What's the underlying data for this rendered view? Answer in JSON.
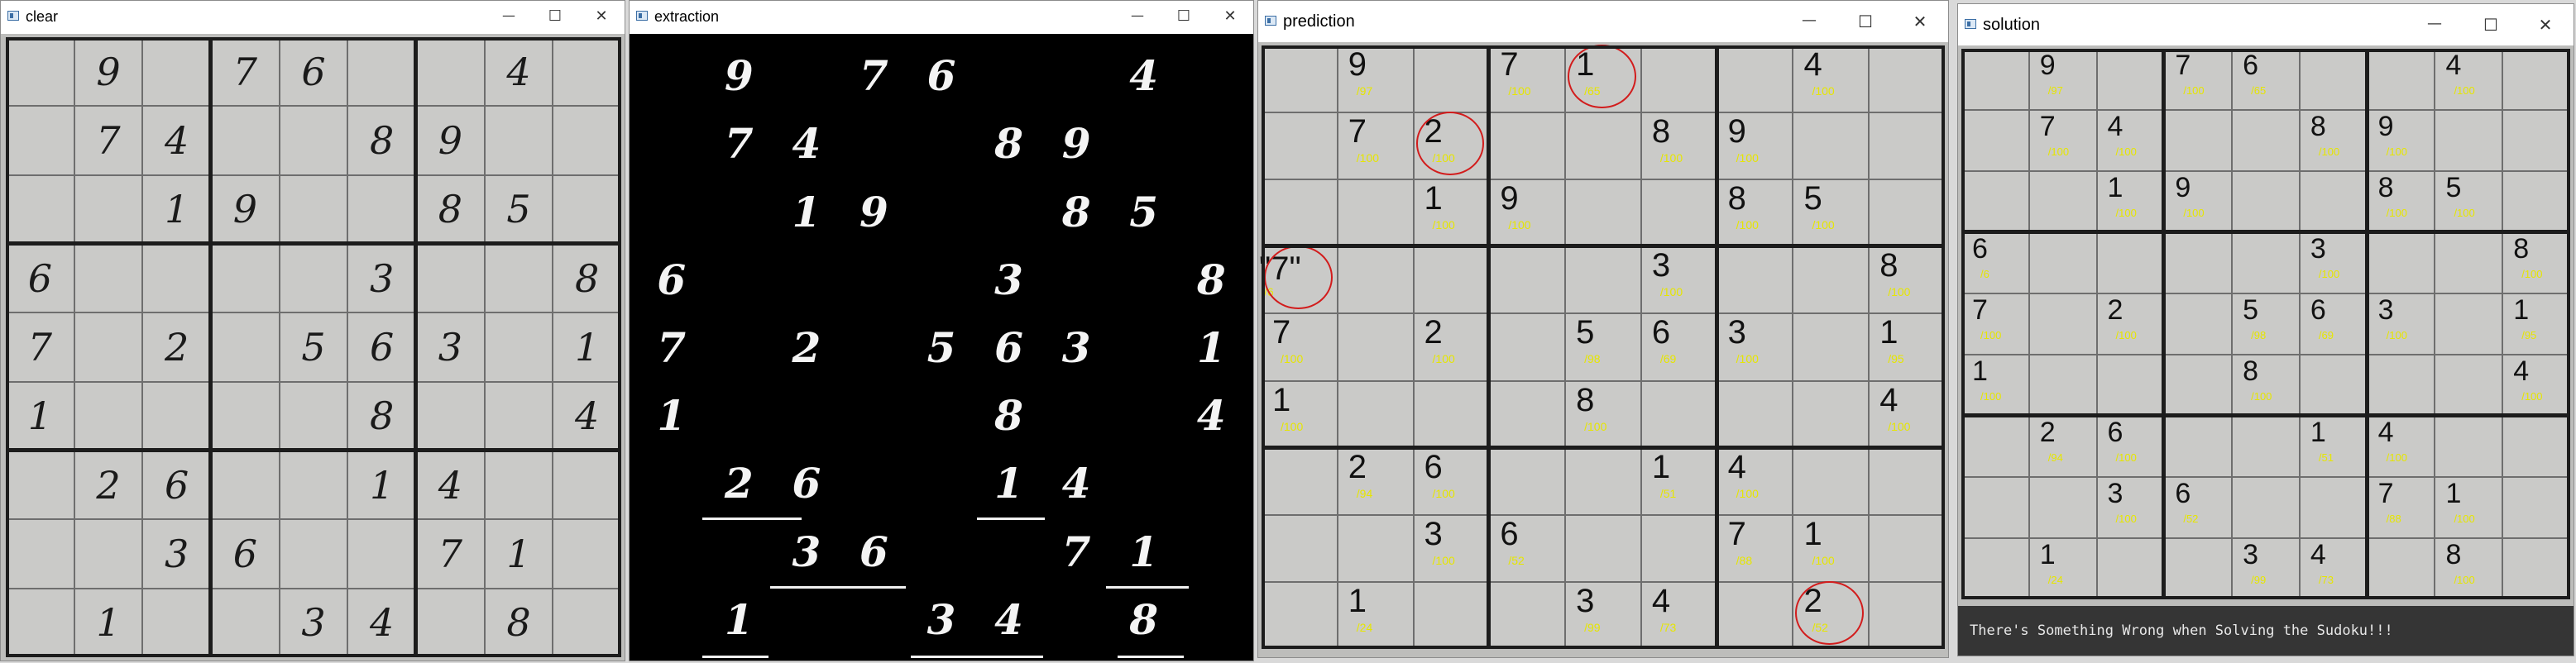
{
  "windows": {
    "clear": {
      "title": "clear",
      "minimize": "—",
      "maximize": "☐",
      "close": "✕"
    },
    "extraction": {
      "title": "extraction",
      "minimize": "—",
      "maximize": "☐",
      "close": "✕"
    },
    "prediction": {
      "title": "prediction",
      "minimize": "—",
      "maximize": "☐",
      "close": "✕"
    },
    "solution": {
      "title": "solution",
      "minimize": "—",
      "maximize": "☐",
      "close": "✕"
    }
  },
  "clear_grid": [
    [
      "",
      "9",
      "",
      "7",
      "6",
      "",
      "",
      "4",
      ""
    ],
    [
      "",
      "7",
      "4",
      "",
      "",
      "8",
      "9",
      "",
      ""
    ],
    [
      "",
      "",
      "1",
      "9",
      "",
      "",
      "8",
      "5",
      ""
    ],
    [
      "6",
      "",
      "",
      "",
      "",
      "3",
      "",
      "",
      "8"
    ],
    [
      "7",
      "",
      "2",
      "",
      "5",
      "6",
      "3",
      "",
      "1"
    ],
    [
      "1",
      "",
      "",
      "",
      "",
      "8",
      "",
      "",
      "4"
    ],
    [
      "",
      "2",
      "6",
      "",
      "",
      "1",
      "4",
      "",
      ""
    ],
    [
      "",
      "",
      "3",
      "6",
      "",
      "",
      "7",
      "1",
      ""
    ],
    [
      "",
      "1",
      "",
      "",
      "3",
      "4",
      "",
      "8",
      ""
    ]
  ],
  "prediction_grid": [
    [
      "",
      {
        "d": "9",
        "c": "/97"
      },
      "",
      {
        "d": "7",
        "c": "/100"
      },
      {
        "d": "1",
        "c": "/65",
        "circled": true
      },
      "",
      "",
      {
        "d": "4",
        "c": "/100"
      },
      ""
    ],
    [
      "",
      {
        "d": "7",
        "c": "/100"
      },
      {
        "d": "2",
        "c": "/100",
        "circled": true
      },
      "",
      "",
      {
        "d": "8",
        "c": "/100"
      },
      {
        "d": "9",
        "c": "/100"
      },
      "",
      ""
    ],
    [
      "",
      "",
      {
        "d": "1",
        "c": "/100"
      },
      {
        "d": "9",
        "c": "/100"
      },
      "",
      "",
      {
        "d": "8",
        "c": "/100"
      },
      {
        "d": "5",
        "c": "/100"
      },
      ""
    ],
    [
      {
        "d": "\"7\"",
        "c": "/6",
        "circled": true,
        "quoted": true
      },
      "",
      "",
      "",
      "",
      {
        "d": "3",
        "c": "/100"
      },
      "",
      "",
      {
        "d": "8",
        "c": "/100"
      }
    ],
    [
      {
        "d": "7",
        "c": "/100"
      },
      "",
      {
        "d": "2",
        "c": "/100"
      },
      "",
      {
        "d": "5",
        "c": "/98"
      },
      {
        "d": "6",
        "c": "/69"
      },
      {
        "d": "3",
        "c": "/100"
      },
      "",
      {
        "d": "1",
        "c": "/95"
      }
    ],
    [
      {
        "d": "1",
        "c": "/100"
      },
      "",
      "",
      "",
      {
        "d": "8",
        "c": "/100"
      },
      "",
      "",
      "",
      {
        "d": "4",
        "c": "/100"
      }
    ],
    [
      "",
      {
        "d": "2",
        "c": "/94"
      },
      {
        "d": "6",
        "c": "/100"
      },
      "",
      "",
      {
        "d": "1",
        "c": "/51"
      },
      {
        "d": "4",
        "c": "/100"
      },
      "",
      ""
    ],
    [
      "",
      "",
      {
        "d": "3",
        "c": "/100"
      },
      {
        "d": "6",
        "c": "/52"
      },
      "",
      "",
      {
        "d": "7",
        "c": "/88"
      },
      {
        "d": "1",
        "c": "/100"
      },
      ""
    ],
    [
      "",
      {
        "d": "1",
        "c": "/24"
      },
      "",
      "",
      {
        "d": "3",
        "c": "/99"
      },
      {
        "d": "4",
        "c": "/73"
      },
      "",
      {
        "d": "2",
        "c": "/52",
        "circled": true
      },
      ""
    ]
  ],
  "solution_grid": [
    [
      "",
      {
        "d": "9",
        "c": "/97"
      },
      "",
      {
        "d": "7",
        "c": "/100"
      },
      {
        "d": "6",
        "c": "/65"
      },
      "",
      "",
      {
        "d": "4",
        "c": "/100"
      },
      ""
    ],
    [
      "",
      {
        "d": "7",
        "c": "/100"
      },
      {
        "d": "4",
        "c": "/100"
      },
      "",
      "",
      {
        "d": "8",
        "c": "/100"
      },
      {
        "d": "9",
        "c": "/100"
      },
      "",
      ""
    ],
    [
      "",
      "",
      {
        "d": "1",
        "c": "/100"
      },
      {
        "d": "9",
        "c": "/100"
      },
      "",
      "",
      {
        "d": "8",
        "c": "/100"
      },
      {
        "d": "5",
        "c": "/100"
      },
      ""
    ],
    [
      {
        "d": "6",
        "c": "/6"
      },
      "",
      "",
      "",
      "",
      {
        "d": "3",
        "c": "/100"
      },
      "",
      "",
      {
        "d": "8",
        "c": "/100"
      }
    ],
    [
      {
        "d": "7",
        "c": "/100"
      },
      "",
      {
        "d": "2",
        "c": "/100"
      },
      "",
      {
        "d": "5",
        "c": "/98"
      },
      {
        "d": "6",
        "c": "/69"
      },
      {
        "d": "3",
        "c": "/100"
      },
      "",
      {
        "d": "1",
        "c": "/95"
      }
    ],
    [
      {
        "d": "1",
        "c": "/100"
      },
      "",
      "",
      "",
      {
        "d": "8",
        "c": "/100"
      },
      "",
      "",
      "",
      {
        "d": "4",
        "c": "/100"
      }
    ],
    [
      "",
      {
        "d": "2",
        "c": "/94"
      },
      {
        "d": "6",
        "c": "/100"
      },
      "",
      "",
      {
        "d": "1",
        "c": "/51"
      },
      {
        "d": "4",
        "c": "/100"
      },
      "",
      ""
    ],
    [
      "",
      "",
      {
        "d": "3",
        "c": "/100"
      },
      {
        "d": "6",
        "c": "/52"
      },
      "",
      "",
      {
        "d": "7",
        "c": "/88"
      },
      {
        "d": "1",
        "c": "/100"
      },
      ""
    ],
    [
      "",
      {
        "d": "1",
        "c": "/24"
      },
      "",
      "",
      {
        "d": "3",
        "c": "/99"
      },
      {
        "d": "4",
        "c": "/73"
      },
      "",
      {
        "d": "8",
        "c": "/100"
      },
      ""
    ]
  ],
  "solution_message": "There's Something Wrong when Solving the Sudoku!!!",
  "colors": {
    "confidence_text": "#e6e600",
    "circle": "#d21c1c",
    "extraction_bg": "#000000"
  }
}
